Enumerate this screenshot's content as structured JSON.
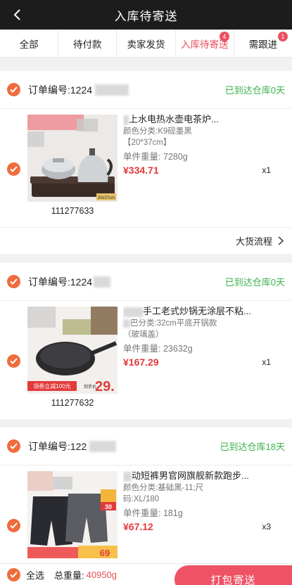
{
  "header": {
    "title": "入库待寄送"
  },
  "tabs": [
    {
      "label": "全部",
      "badge": ""
    },
    {
      "label": "待付款",
      "badge": ""
    },
    {
      "label": "卖家发货",
      "badge": ""
    },
    {
      "label": "入库待寄送",
      "badge": "4"
    },
    {
      "label": "需跟进",
      "badge": "1"
    }
  ],
  "orders": [
    {
      "order_label": "订单编号:1224",
      "status": "已到达仓库0天",
      "item": {
        "name": "上水电热水壶电茶炉...",
        "spec_line1": "颜色分类:K9砚墨黑",
        "spec_line2": "【20*37cm】",
        "weight": "单件重量: 7280g",
        "price": "¥334.71",
        "qty": "x1",
        "sku": "111277633",
        "img_text": "20x37cm"
      },
      "flow_label": "大货流程"
    },
    {
      "order_label": "订单编号:1224",
      "status": "已到达仓库0天",
      "item": {
        "name": "手工老式炒锅无涂层不粘...",
        "spec_line1": "巴分类:32cm平底开锅款",
        "spec_line2": "（玻璃盖）",
        "weight": "单件重量: 23632g",
        "price": "¥167.29",
        "qty": "x1",
        "sku": "111277632",
        "img_coupon": "领券立减100元",
        "img_price_tag": "到手价",
        "img_price": "29."
      }
    },
    {
      "order_label": "订单编号:122",
      "status": "已到达仓库18天",
      "item": {
        "name": "动短裤男官网旗舰新款跑步...",
        "spec_line1": "颜色分类:基础黑-11;尺",
        "spec_line2": "码:XL/180",
        "weight": "单件重量: 181g",
        "price": "¥67.12",
        "qty": "x3",
        "img_badge_top": "30",
        "img_badge_bottom": "69"
      }
    }
  ],
  "footer": {
    "select_all": "全选",
    "total_weight_label": "总重量:",
    "total_weight_value": "40950g",
    "ship_button": "打包寄送"
  },
  "colors": {
    "accent": "#ee5264",
    "check": "#ef6c3d",
    "status_green": "#3bb24b",
    "price_red": "#e4393c"
  }
}
